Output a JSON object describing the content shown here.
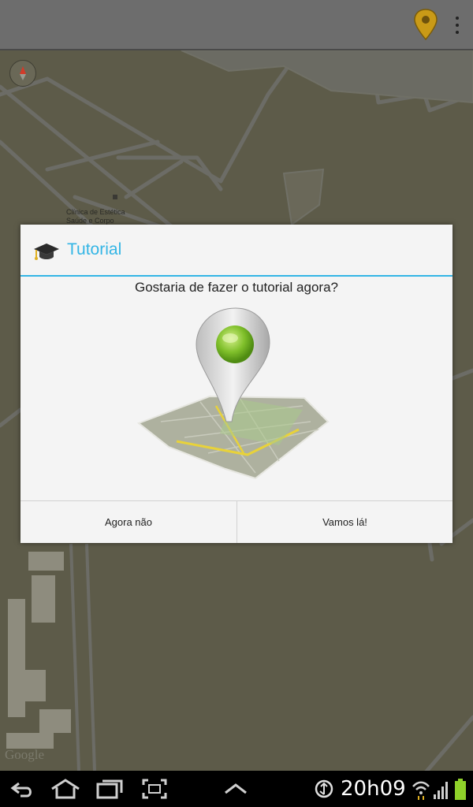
{
  "action_bar": {
    "icons": [
      "location-pin-icon",
      "overflow-menu-icon"
    ],
    "pin_color": "#c99a17"
  },
  "map": {
    "poi_name_line1": "Clínica de Estética",
    "poi_name_line2": "Saúde e Corpo",
    "attribution": "Google",
    "land_color": "#5d5b49",
    "road_color": "#6c6c66"
  },
  "dialog": {
    "title": "Tutorial",
    "message": "Gostaria de fazer o tutorial agora?",
    "negative_button": "Agora não",
    "positive_button": "Vamos lá!",
    "accent_color": "#33b5e5",
    "title_icon": "graduation-cap-icon",
    "illustration": "map-location-pin-illustration"
  },
  "system_bar": {
    "time": "20h09",
    "icons": [
      "back-icon",
      "home-icon",
      "recent-apps-icon",
      "screenshot-icon",
      "up-arrow-icon",
      "usb-debug-icon",
      "wifi-icon",
      "signal-icon",
      "battery-icon"
    ]
  }
}
